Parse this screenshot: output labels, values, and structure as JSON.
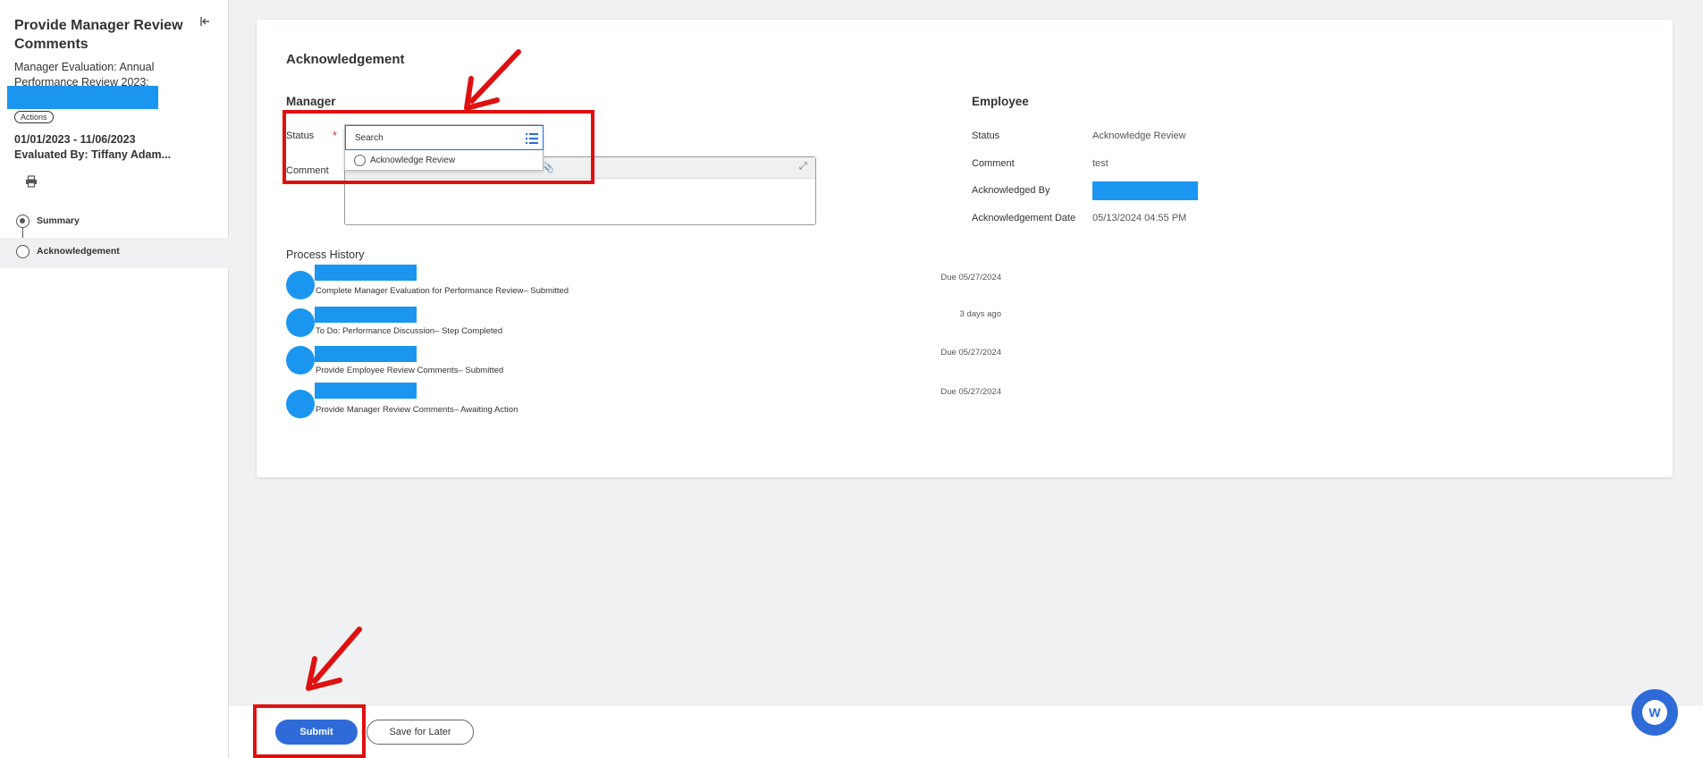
{
  "sidebar": {
    "title": "Provide Manager Review Comments",
    "subtitle": "Manager Evaluation: Annual Performance Review 2023:",
    "actions_label": "Actions",
    "dates": "01/01/2023 - 11/06/2023",
    "evaluated_by": "Evaluated By: Tiffany Adam...",
    "steps": [
      {
        "label": "Summary"
      },
      {
        "label": "Acknowledgement"
      }
    ]
  },
  "card": {
    "title": "Acknowledgement",
    "manager": {
      "heading": "Manager",
      "status_label": "Status",
      "required_mark": "*",
      "search_placeholder": "Search",
      "option_label": "Acknowledge Review",
      "comment_label": "Comment"
    },
    "employee": {
      "heading": "Employee",
      "status_label": "Status",
      "status_value": "Acknowledge Review",
      "comment_label": "Comment",
      "comment_value": "test",
      "ack_by_label": "Acknowledged By",
      "ack_date_label": "Acknowledgement Date",
      "ack_date_value": "05/13/2024 04:55 PM"
    },
    "process_history": {
      "heading": "Process History",
      "items": [
        {
          "text": "Complete Manager Evaluation for Performance Review– Submitted",
          "due": "Due 05/27/2024"
        },
        {
          "text": "To Do: Performance Discussion– Step Completed",
          "due": "3 days ago"
        },
        {
          "text": "Provide Employee Review Comments– Submitted",
          "due": "Due 05/27/2024"
        },
        {
          "text": "Provide Manager Review Comments– Awaiting Action",
          "due": "Due 05/27/2024"
        }
      ]
    }
  },
  "footer": {
    "submit_label": "Submit",
    "save_later_label": "Save for Later"
  },
  "colors": {
    "accent": "#2e6bd9",
    "redaction": "#1a96f0",
    "annotation": "#e01010",
    "required": "#d9342b"
  }
}
